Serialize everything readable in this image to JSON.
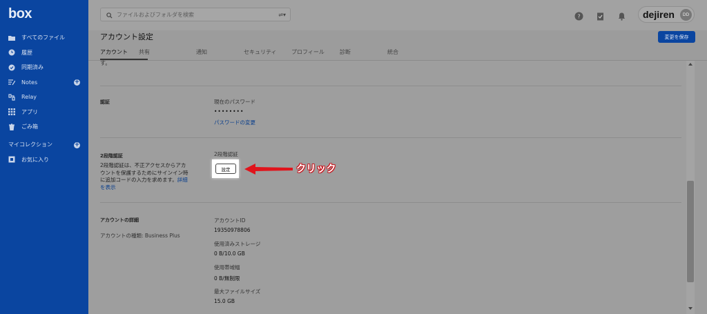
{
  "sidebar": {
    "logo": "box",
    "items": [
      {
        "label": "すべてのファイル",
        "icon": "folder-icon"
      },
      {
        "label": "履歴",
        "icon": "clock-icon"
      },
      {
        "label": "同期済み",
        "icon": "check-circle-icon"
      },
      {
        "label": "Notes",
        "icon": "notes-icon"
      },
      {
        "label": "Relay",
        "icon": "relay-icon"
      },
      {
        "label": "アプリ",
        "icon": "grid-icon"
      },
      {
        "label": "ごみ箱",
        "icon": "trash-icon"
      }
    ],
    "collections_label": "マイコレクション",
    "favorites_label": "お気に入り"
  },
  "topbar": {
    "search_placeholder": "ファイルおよびフォルダを検索",
    "user_name": "dejiren",
    "avatar_initials": "DD"
  },
  "header": {
    "title": "アカウント設定",
    "save_label": "変更を保存",
    "tabs": [
      "アカウント",
      "共有",
      "通知",
      "セキュリティ",
      "プロフィール",
      "診断",
      "統合"
    ]
  },
  "content": {
    "fragment": "す。",
    "auth_label": "認証",
    "current_password_label": "現在のパスワード",
    "password_mask": "••••••••",
    "change_password_link": "パスワードの変更",
    "twofa_label": "2段階認証",
    "twofa_desc": "2段階認証は、不正アクセスからアカウントを保護するためにサインイン時に追加コードの入力を求めます。",
    "twofa_more_link": "詳細を表示",
    "twofa_field_label": "2段階認証",
    "setup_button": "設定",
    "account_details_label": "アカウントの詳細",
    "account_type_text": "アカウントの種類: Business Plus",
    "account_id_label": "アカウントID",
    "account_id_value": "19350978806",
    "storage_used_label": "使用済みストレージ",
    "storage_used_value": "0 B/10.0 GB",
    "bandwidth_label": "使用帯域幅",
    "bandwidth_value": "0 B/無制限",
    "max_file_label": "最大ファイルサイズ",
    "max_file_value": "15.0 GB"
  },
  "annotation": {
    "click_label": "クリック",
    "arrow_color": "#e0141c"
  }
}
